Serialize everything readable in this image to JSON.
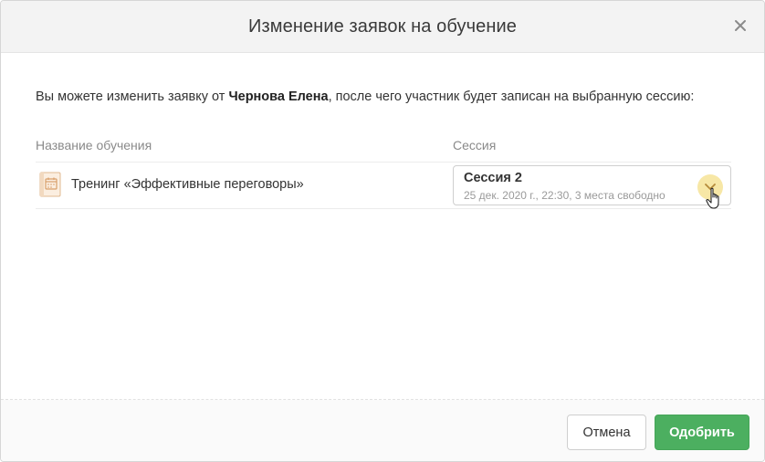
{
  "dialog": {
    "title": "Изменение заявок на обучение",
    "close_icon": "close-icon"
  },
  "intro": {
    "prefix": "Вы можете изменить заявку от ",
    "name": "Чернова Елена",
    "suffix": ", после чего участник будет записан на выбранную сессию:"
  },
  "table": {
    "headers": {
      "course": "Название обучения",
      "session": "Сессия"
    },
    "rows": [
      {
        "icon": "calendar-icon",
        "course": "Тренинг «Эффективные переговоры»",
        "session": {
          "title": "Сессия 2",
          "details": "25 дек. 2020 г., 22:30, 3 места свободно"
        }
      }
    ]
  },
  "footer": {
    "cancel_label": "Отмена",
    "approve_label": "Одобрить"
  },
  "colors": {
    "approve": "#4caf60",
    "chevron_highlight": "#f7e7a6",
    "header_bg": "#f3f3f3"
  }
}
